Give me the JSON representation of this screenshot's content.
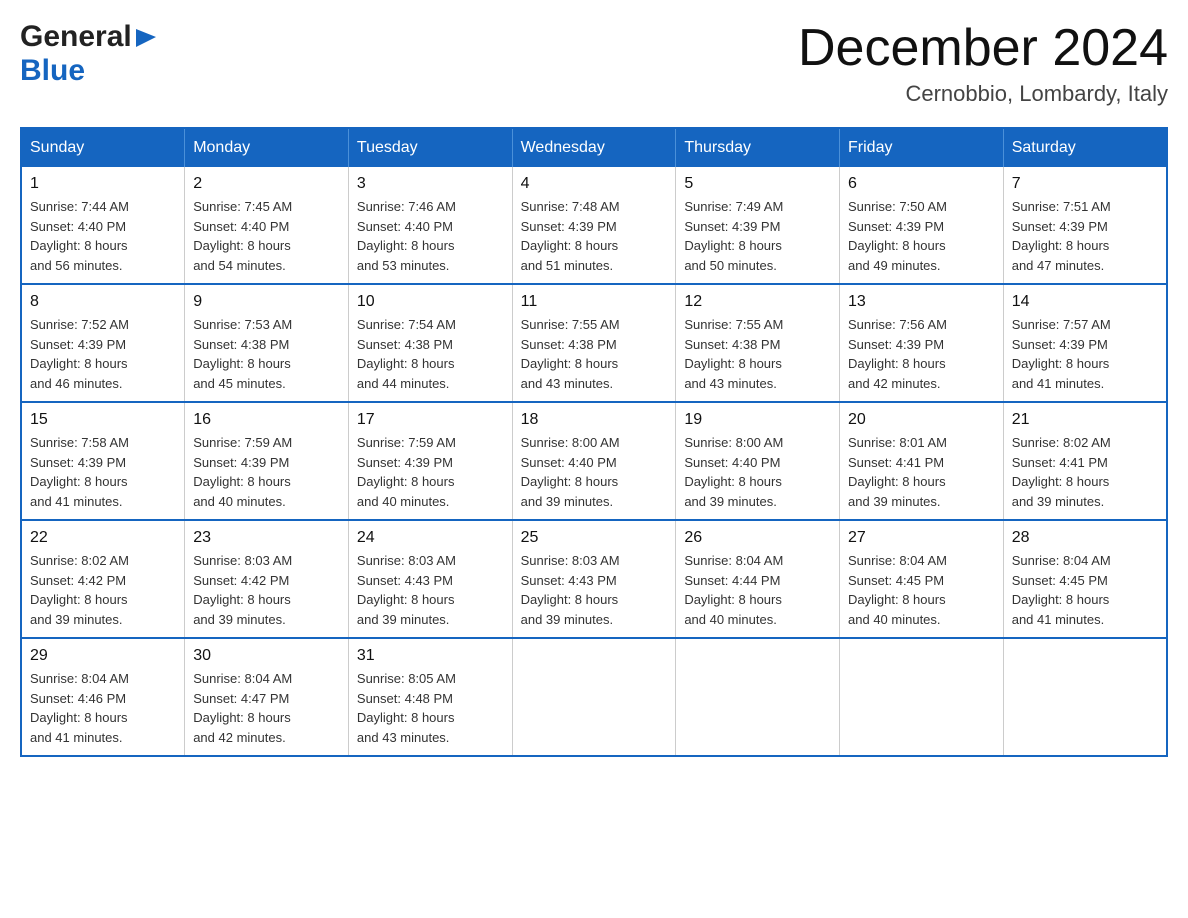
{
  "header": {
    "logo_general": "General",
    "logo_blue": "Blue",
    "month_title": "December 2024",
    "subtitle": "Cernobbio, Lombardy, Italy"
  },
  "days_of_week": [
    "Sunday",
    "Monday",
    "Tuesday",
    "Wednesday",
    "Thursday",
    "Friday",
    "Saturday"
  ],
  "weeks": [
    [
      {
        "day": "1",
        "sunrise": "7:44 AM",
        "sunset": "4:40 PM",
        "daylight": "8 hours and 56 minutes."
      },
      {
        "day": "2",
        "sunrise": "7:45 AM",
        "sunset": "4:40 PM",
        "daylight": "8 hours and 54 minutes."
      },
      {
        "day": "3",
        "sunrise": "7:46 AM",
        "sunset": "4:40 PM",
        "daylight": "8 hours and 53 minutes."
      },
      {
        "day": "4",
        "sunrise": "7:48 AM",
        "sunset": "4:39 PM",
        "daylight": "8 hours and 51 minutes."
      },
      {
        "day": "5",
        "sunrise": "7:49 AM",
        "sunset": "4:39 PM",
        "daylight": "8 hours and 50 minutes."
      },
      {
        "day": "6",
        "sunrise": "7:50 AM",
        "sunset": "4:39 PM",
        "daylight": "8 hours and 49 minutes."
      },
      {
        "day": "7",
        "sunrise": "7:51 AM",
        "sunset": "4:39 PM",
        "daylight": "8 hours and 47 minutes."
      }
    ],
    [
      {
        "day": "8",
        "sunrise": "7:52 AM",
        "sunset": "4:39 PM",
        "daylight": "8 hours and 46 minutes."
      },
      {
        "day": "9",
        "sunrise": "7:53 AM",
        "sunset": "4:38 PM",
        "daylight": "8 hours and 45 minutes."
      },
      {
        "day": "10",
        "sunrise": "7:54 AM",
        "sunset": "4:38 PM",
        "daylight": "8 hours and 44 minutes."
      },
      {
        "day": "11",
        "sunrise": "7:55 AM",
        "sunset": "4:38 PM",
        "daylight": "8 hours and 43 minutes."
      },
      {
        "day": "12",
        "sunrise": "7:55 AM",
        "sunset": "4:38 PM",
        "daylight": "8 hours and 43 minutes."
      },
      {
        "day": "13",
        "sunrise": "7:56 AM",
        "sunset": "4:39 PM",
        "daylight": "8 hours and 42 minutes."
      },
      {
        "day": "14",
        "sunrise": "7:57 AM",
        "sunset": "4:39 PM",
        "daylight": "8 hours and 41 minutes."
      }
    ],
    [
      {
        "day": "15",
        "sunrise": "7:58 AM",
        "sunset": "4:39 PM",
        "daylight": "8 hours and 41 minutes."
      },
      {
        "day": "16",
        "sunrise": "7:59 AM",
        "sunset": "4:39 PM",
        "daylight": "8 hours and 40 minutes."
      },
      {
        "day": "17",
        "sunrise": "7:59 AM",
        "sunset": "4:39 PM",
        "daylight": "8 hours and 40 minutes."
      },
      {
        "day": "18",
        "sunrise": "8:00 AM",
        "sunset": "4:40 PM",
        "daylight": "8 hours and 39 minutes."
      },
      {
        "day": "19",
        "sunrise": "8:00 AM",
        "sunset": "4:40 PM",
        "daylight": "8 hours and 39 minutes."
      },
      {
        "day": "20",
        "sunrise": "8:01 AM",
        "sunset": "4:41 PM",
        "daylight": "8 hours and 39 minutes."
      },
      {
        "day": "21",
        "sunrise": "8:02 AM",
        "sunset": "4:41 PM",
        "daylight": "8 hours and 39 minutes."
      }
    ],
    [
      {
        "day": "22",
        "sunrise": "8:02 AM",
        "sunset": "4:42 PM",
        "daylight": "8 hours and 39 minutes."
      },
      {
        "day": "23",
        "sunrise": "8:03 AM",
        "sunset": "4:42 PM",
        "daylight": "8 hours and 39 minutes."
      },
      {
        "day": "24",
        "sunrise": "8:03 AM",
        "sunset": "4:43 PM",
        "daylight": "8 hours and 39 minutes."
      },
      {
        "day": "25",
        "sunrise": "8:03 AM",
        "sunset": "4:43 PM",
        "daylight": "8 hours and 39 minutes."
      },
      {
        "day": "26",
        "sunrise": "8:04 AM",
        "sunset": "4:44 PM",
        "daylight": "8 hours and 40 minutes."
      },
      {
        "day": "27",
        "sunrise": "8:04 AM",
        "sunset": "4:45 PM",
        "daylight": "8 hours and 40 minutes."
      },
      {
        "day": "28",
        "sunrise": "8:04 AM",
        "sunset": "4:45 PM",
        "daylight": "8 hours and 41 minutes."
      }
    ],
    [
      {
        "day": "29",
        "sunrise": "8:04 AM",
        "sunset": "4:46 PM",
        "daylight": "8 hours and 41 minutes."
      },
      {
        "day": "30",
        "sunrise": "8:04 AM",
        "sunset": "4:47 PM",
        "daylight": "8 hours and 42 minutes."
      },
      {
        "day": "31",
        "sunrise": "8:05 AM",
        "sunset": "4:48 PM",
        "daylight": "8 hours and 43 minutes."
      },
      null,
      null,
      null,
      null
    ]
  ],
  "labels": {
    "sunrise": "Sunrise:",
    "sunset": "Sunset:",
    "daylight": "Daylight:"
  }
}
